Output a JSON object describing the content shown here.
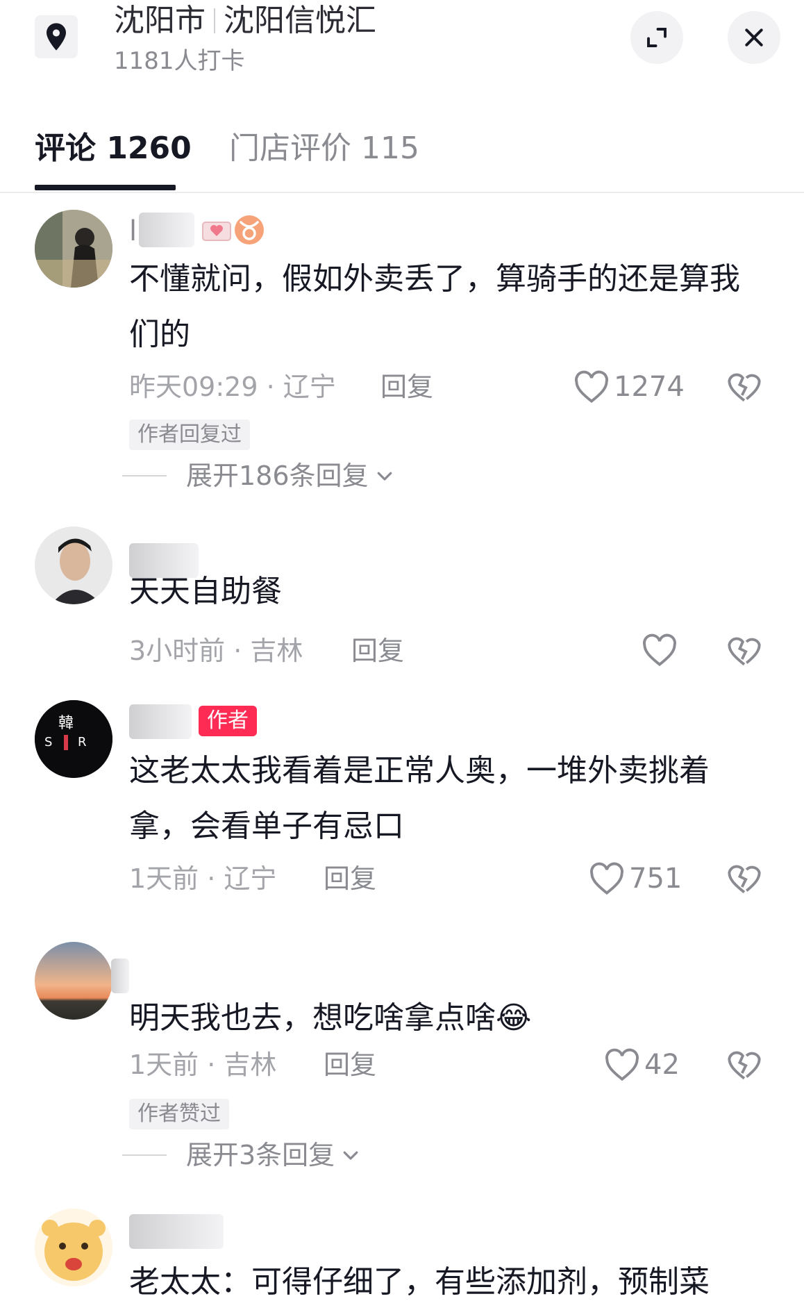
{
  "header": {
    "city": "沈阳市",
    "place": "沈阳信悦汇",
    "checkin": "1181人打卡",
    "location_icon": "map-pin-icon",
    "expand_icon": "expand-icon",
    "close_icon": "close-icon"
  },
  "tabs": [
    {
      "label": "评论 1260",
      "active": true
    },
    {
      "label": "门店评价 115",
      "active": false
    }
  ],
  "comments": [
    {
      "username": "l",
      "text": "不懂就问，假如外卖丢了，算骑手的还是算我们的",
      "time_region": "昨天09:29 · 辽宁",
      "reply": "回复",
      "likes": "1274",
      "tag": "作者回复过",
      "expand": "展开186条回复"
    },
    {
      "text": "天天自助餐",
      "time_region": "3小时前 · 吉林",
      "reply": "回复",
      "likes": ""
    },
    {
      "badge": "作者",
      "text": "这老太太我看着是正常人奥，一堆外卖挑着拿，会看单子有忌口",
      "time_region": "1天前 · 辽宁",
      "reply": "回复",
      "likes": "751"
    },
    {
      "text": "明天我也去，想吃啥拿点啥",
      "emoji": "😂",
      "time_region": "1天前 · 吉林",
      "reply": "回复",
      "likes": "42",
      "tag": "作者赞过",
      "expand": "展开3条回复"
    },
    {
      "text": "老太太：可得仔细了，有些添加剂，预制菜"
    }
  ],
  "colors": {
    "accent": "#fe2c55",
    "text": "#161823",
    "muted": "#8a8b91"
  }
}
